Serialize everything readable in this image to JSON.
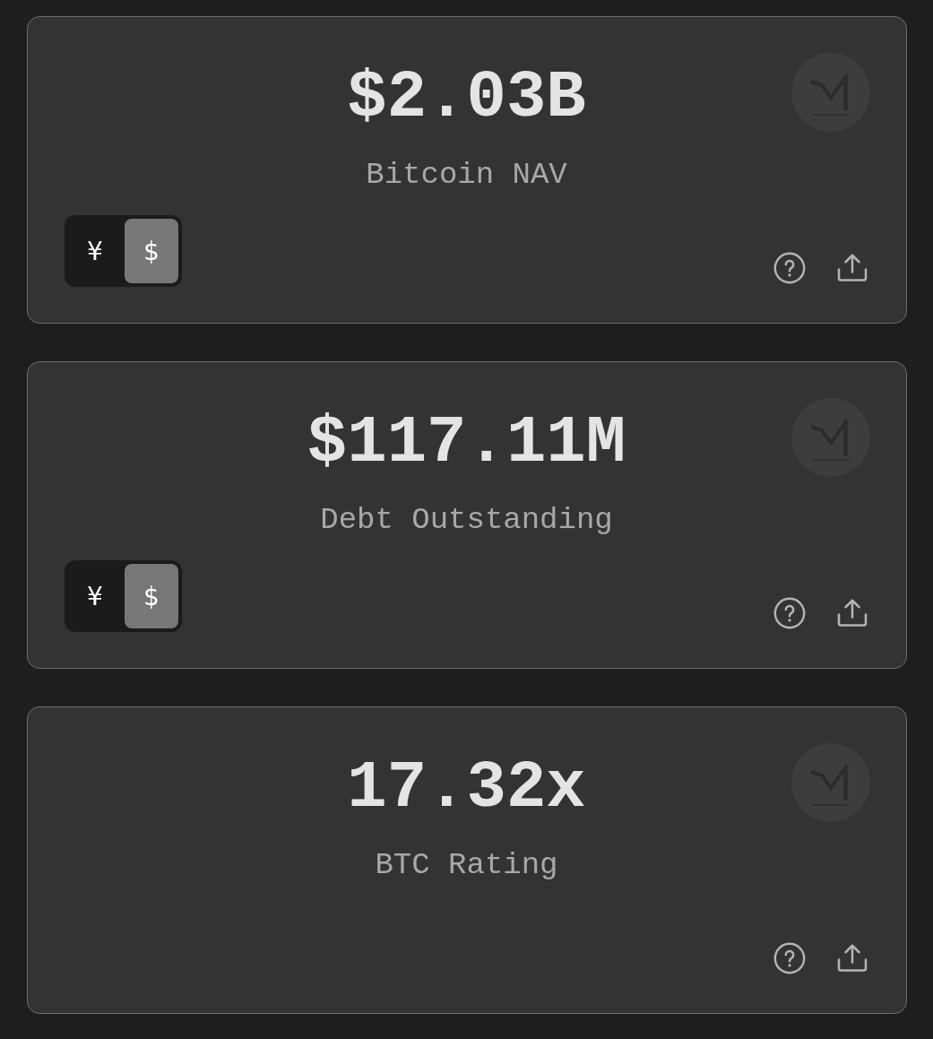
{
  "cards": [
    {
      "value": "$2.03B",
      "label": "Bitcoin NAV",
      "currency_toggle": {
        "options": [
          {
            "label": "¥",
            "selected": false
          },
          {
            "label": "$",
            "selected": true
          }
        ]
      }
    },
    {
      "value": "$117.11M",
      "label": "Debt Outstanding",
      "currency_toggle": {
        "options": [
          {
            "label": "¥",
            "selected": false
          },
          {
            "label": "$",
            "selected": true
          }
        ]
      }
    },
    {
      "value": "17.32x",
      "label": "BTC Rating"
    }
  ]
}
